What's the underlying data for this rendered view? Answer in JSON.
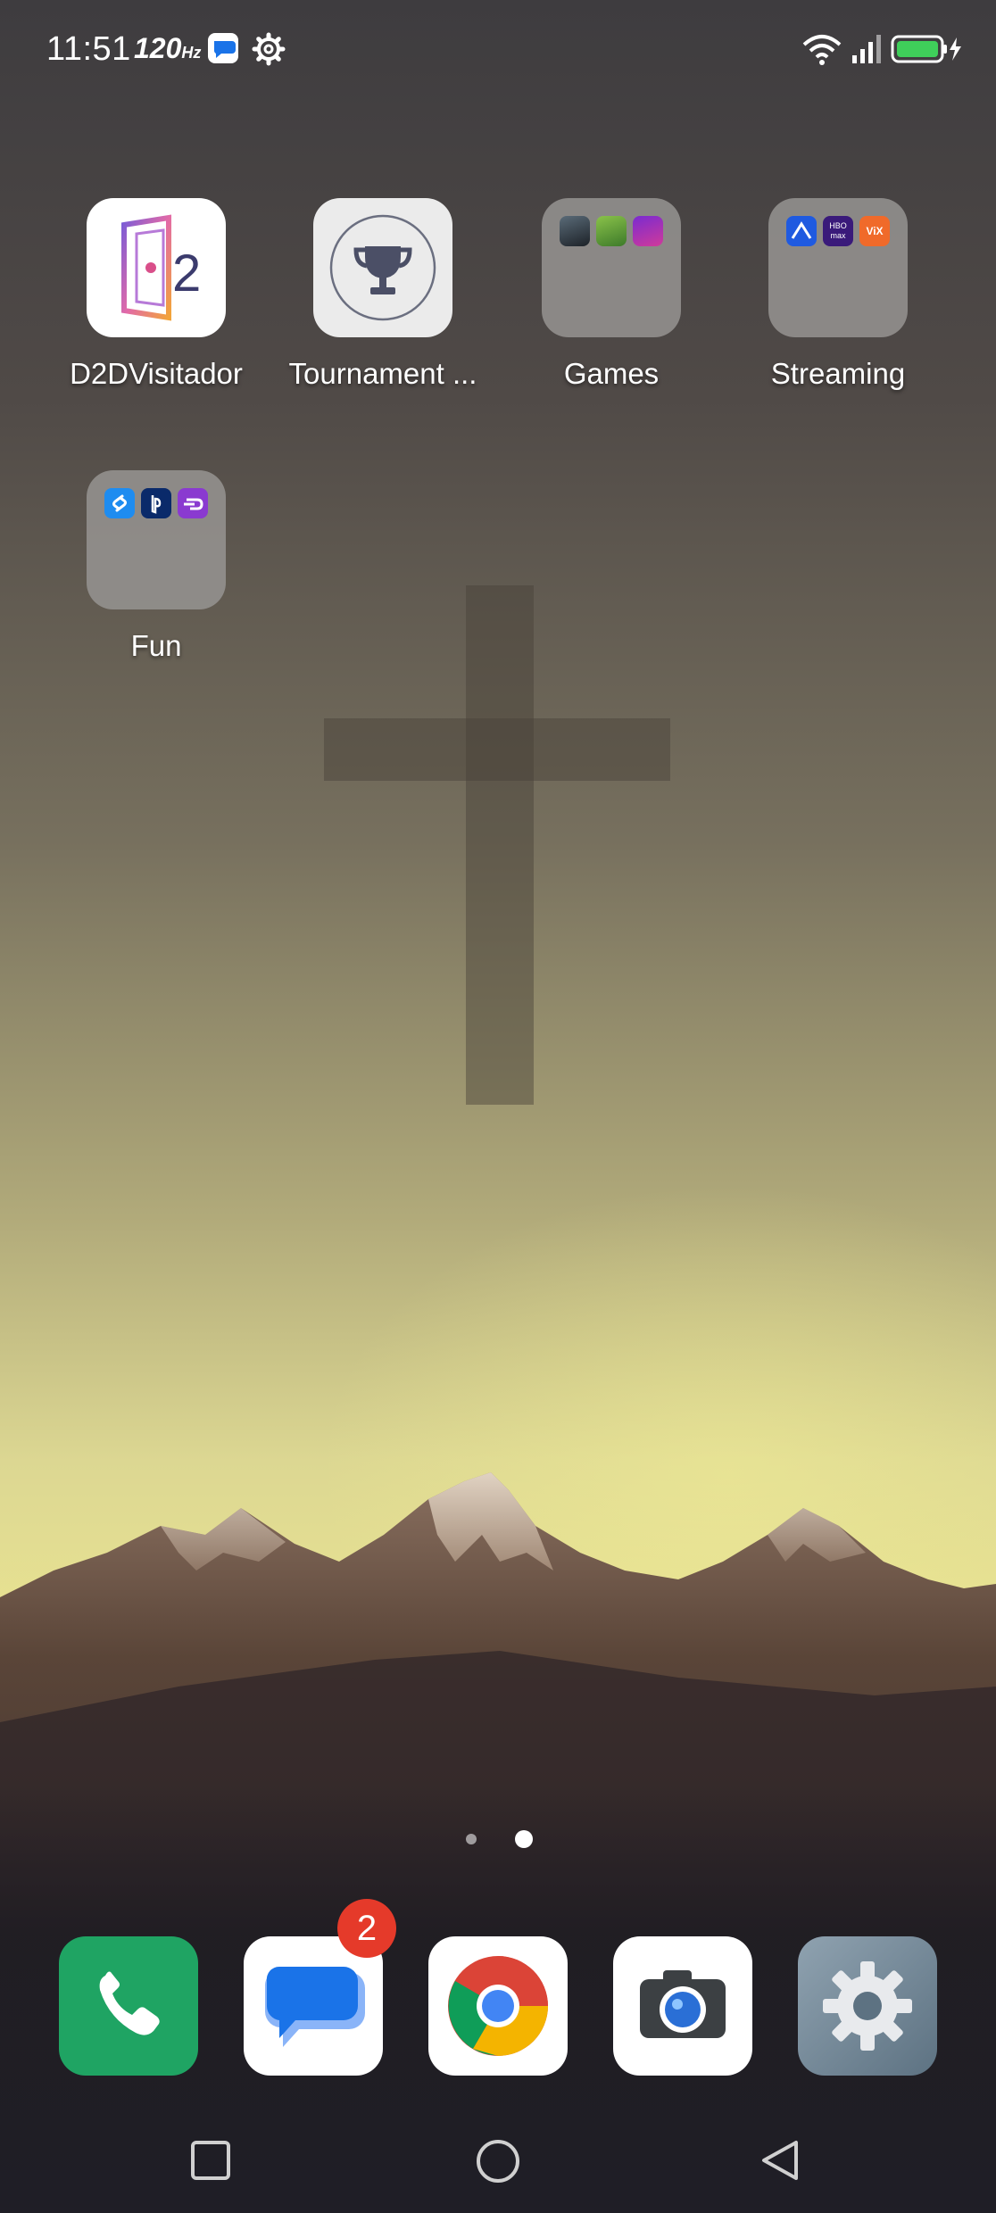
{
  "status_bar": {
    "time": "11:51",
    "refresh_rate": "120",
    "refresh_unit": "Hz",
    "icons": [
      "messages-icon",
      "gear-icon",
      "wifi-icon",
      "signal-icon",
      "battery-charging-icon"
    ]
  },
  "home_apps": [
    {
      "label": "D2DVisitador",
      "icon": "d2d-visitador-icon"
    },
    {
      "label": "Tournament ...",
      "icon": "trophy-icon"
    },
    {
      "label": "Games",
      "icon": "folder-icon"
    },
    {
      "label": "Streaming",
      "icon": "folder-icon"
    },
    {
      "label": "Fun",
      "icon": "folder-icon"
    }
  ],
  "folder_previews": {
    "games": [
      "call-of-duty-icon",
      "game-character-icon",
      "purple-game-icon"
    ],
    "streaming": [
      "paramount-icon",
      "hbo-max-icon",
      "vix-icon"
    ],
    "fun": [
      "shazam-icon",
      "playstation-icon",
      "purple-app-icon"
    ],
    "hbo_text": "HBO max",
    "vix_text": "ViX"
  },
  "page_indicator": {
    "pages": 2,
    "current": 2
  },
  "dock": [
    {
      "name": "phone",
      "icon": "phone-icon"
    },
    {
      "name": "messages",
      "icon": "messages-icon",
      "badge": "2"
    },
    {
      "name": "chrome",
      "icon": "chrome-icon"
    },
    {
      "name": "camera",
      "icon": "camera-icon"
    },
    {
      "name": "settings",
      "icon": "settings-icon"
    }
  ],
  "nav_bar": [
    "recents-button",
    "home-button",
    "back-button"
  ],
  "colors": {
    "battery": "#3fcf5a",
    "badge": "#e53a2a",
    "phone": "#1fa463",
    "messages_bubble": "#1a73e8"
  }
}
